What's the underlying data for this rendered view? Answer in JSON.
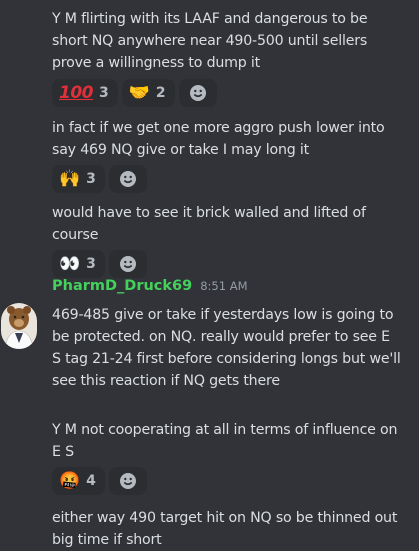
{
  "messages": [
    {
      "text_lines": [
        "Y M flirting with its LAAF and dangerous to be",
        "short NQ anywhere near 490-500 until sellers",
        "prove a willingness to dump it"
      ]
    },
    {
      "text_lines": [
        "in fact if we get one more aggro push lower into",
        "say 469 NQ give or take I may long it"
      ]
    },
    {
      "text_lines": [
        "would have to see it brick walled and lifted of",
        "course"
      ]
    },
    {
      "author": "PharmD_Druck69",
      "timestamp": "8:51 AM",
      "text_lines": [
        "469-485 give or take if yesterdays low is going to",
        "be protected. on NQ. really would prefer to see E",
        "S tag 21-24 first before considering longs but we'll",
        "see this reaction  if NQ gets there"
      ]
    },
    {
      "text_lines": [
        "Y M not cooperating at all in terms of influence on",
        "E S"
      ]
    },
    {
      "text_lines": [
        "either way 490 target hit on NQ so be thinned out",
        "big time if short"
      ]
    }
  ],
  "reactions": {
    "msg1": [
      {
        "emoji": "hundred-points",
        "glyph": "100",
        "count": "3"
      },
      {
        "emoji": "handshake",
        "glyph": "🤝",
        "count": "2"
      }
    ],
    "msg2": [
      {
        "emoji": "raising-hands",
        "glyph": "🙌",
        "count": "3"
      }
    ],
    "msg3": [
      {
        "emoji": "eyes",
        "glyph": "👀",
        "count": "3"
      }
    ],
    "msg5": [
      {
        "emoji": "face-with-symbols-on-mouth",
        "glyph": "🤬",
        "count": "4"
      }
    ]
  },
  "colors": {
    "background": "#313338",
    "reaction_bg": "#2b2d31",
    "username": "#43d15b",
    "text": "#dbdee1",
    "muted": "#949ba4"
  }
}
